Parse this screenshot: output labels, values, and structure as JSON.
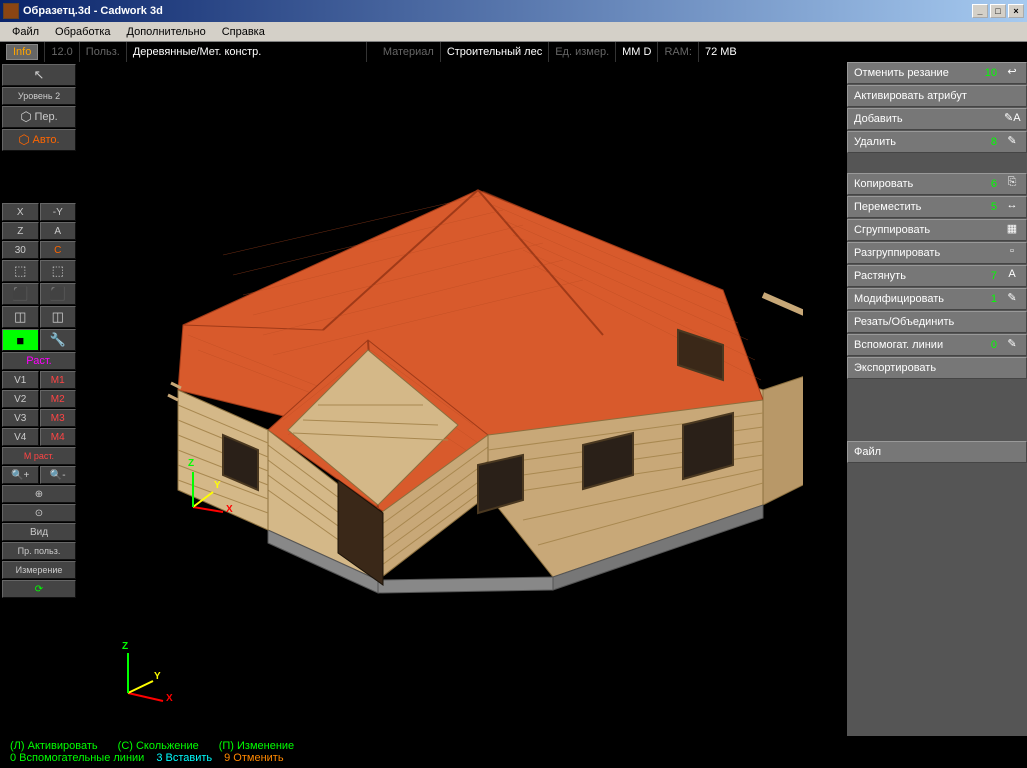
{
  "titlebar": {
    "title": "Образетц.3d - Cadwork 3d"
  },
  "menubar": {
    "items": [
      "Файл",
      "Обработка",
      "Дополнительно",
      "Справка"
    ]
  },
  "info_bar": {
    "info_btn": "Info",
    "version": "12.0",
    "user": "Польз.",
    "mode": "Деревянные/Мет. констр.",
    "material_label": "Материал",
    "material_value": "Строительный лес",
    "unit_label": "Ед. измер.",
    "units": "MM  D",
    "ram_label": "RAM:",
    "ram": "72 MB"
  },
  "left_panel": {
    "level": "Уровень 2",
    "per": "Пер.",
    "auto": "Авто.",
    "x": "X",
    "y_neg": "-Y",
    "z": "Z",
    "a": "A",
    "thirty": "30",
    "c": "C",
    "rast": "Раст.",
    "v1": "V1",
    "v2": "V2",
    "v3": "V3",
    "v4": "V4",
    "m1": "M1",
    "m2": "M2",
    "m3": "M3",
    "m4": "M4",
    "m_rast": "М раст.",
    "vid": "Вид",
    "pr_polz": "Пр. польз.",
    "izmerenie": "Измерение"
  },
  "right_panel": {
    "items": [
      {
        "label": "Отменить резание",
        "count": "10",
        "icon": "↩"
      },
      {
        "label": "Активировать атрибут",
        "count": "",
        "icon": ""
      },
      {
        "label": "Добавить",
        "count": "",
        "icon": "✎A"
      },
      {
        "label": "Удалить",
        "count": "8",
        "icon": "✎"
      },
      {
        "spacer": true
      },
      {
        "label": "Копировать",
        "count": "6",
        "icon": "⎘"
      },
      {
        "label": "Переместить",
        "count": "5",
        "icon": "↔"
      },
      {
        "label": "Сгруппировать",
        "count": "",
        "icon": "▦"
      },
      {
        "label": "Разгруппировать",
        "count": "",
        "icon": "▫"
      },
      {
        "label": "Растянуть",
        "count": "7",
        "icon": "A"
      },
      {
        "label": "Модифицировать",
        "count": "1",
        "icon": "✎"
      },
      {
        "label": "Резать/Объединить",
        "count": "",
        "icon": ""
      },
      {
        "label": "Вспомогат. линии",
        "count": "0",
        "icon": "✎"
      },
      {
        "label": "Экспортировать",
        "count": "",
        "icon": ""
      },
      {
        "spacer": true,
        "tall": true
      },
      {
        "label": "Файл",
        "count": "",
        "icon": ""
      }
    ]
  },
  "status_bar": {
    "activate": "(Л) Активировать",
    "slide": "(С) Скольжение",
    "change": "(П) Изменение",
    "aux_lines": "0 Вспомогательные линии",
    "insert": "3 Вставить",
    "cancel": "9 Отменить"
  },
  "axis": {
    "x": "X",
    "y": "Y",
    "z": "Z"
  }
}
